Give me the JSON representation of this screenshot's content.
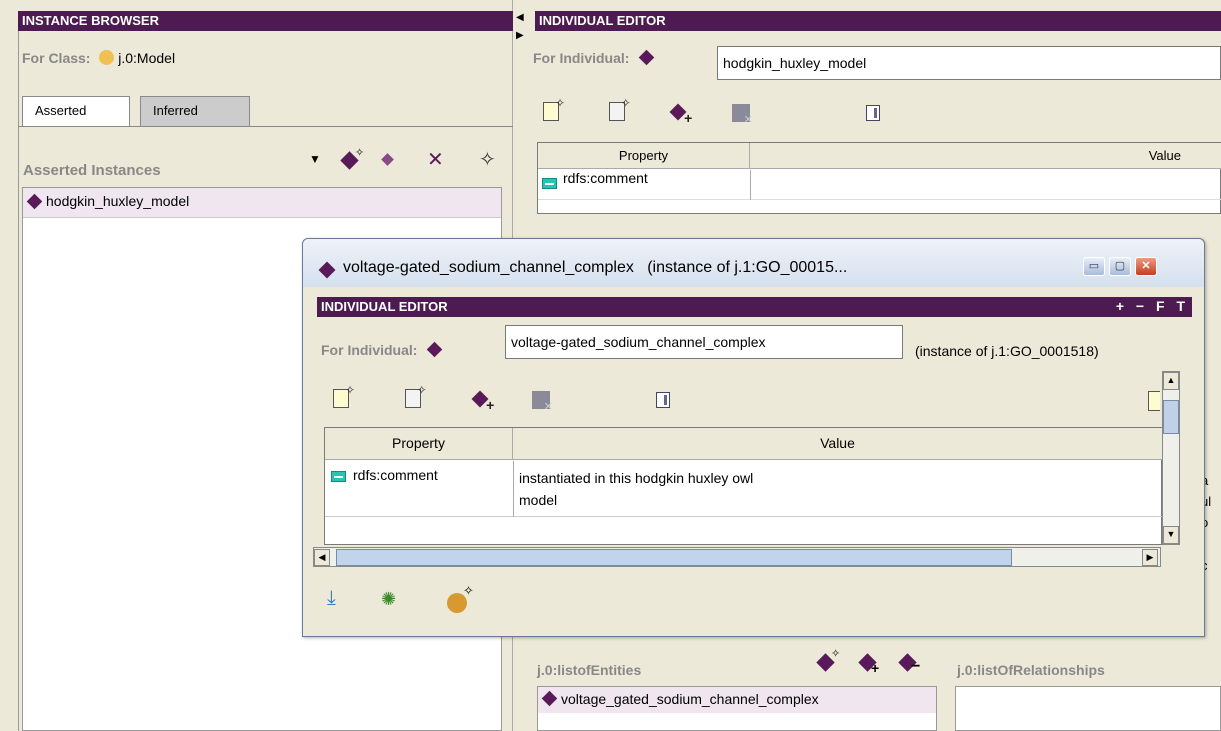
{
  "left": {
    "header": "INSTANCE BROWSER",
    "for_class_label": "For Class:",
    "class_name": "j.0:Model",
    "tabs": [
      {
        "label": "Asserted"
      },
      {
        "label": "Inferred"
      }
    ],
    "section_title": "Asserted Instances",
    "instances": [
      {
        "label": "hodgkin_huxley_model"
      }
    ]
  },
  "right": {
    "header": "INDIVIDUAL EDITOR",
    "for_individual_label": "For Individual:",
    "individual_name": "hodgkin_huxley_model",
    "table": {
      "columns": [
        "Property",
        "Value"
      ],
      "rows": [
        {
          "property": "rdfs:comment",
          "value": ""
        }
      ]
    },
    "list_entities_label": "j.0:listofEntities",
    "list_relationships_label": "j.0:listOfRelationships",
    "entities": [
      {
        "label": "voltage_gated_sodium_channel_complex"
      }
    ],
    "peek_text": [
      "a",
      "ul",
      "o",
      "c"
    ]
  },
  "dialog": {
    "title": "voltage-gated_sodium_channel_complex   (instance of j.1:GO_00015...",
    "header": "INDIVIDUAL EDITOR",
    "header_buttons": [
      "+",
      "−",
      "F",
      "T"
    ],
    "for_individual_label": "For Individual:",
    "individual_name": "voltage-gated_sodium_channel_complex",
    "instance_of": "(instance of j.1:GO_0001518)",
    "table": {
      "columns": [
        "Property",
        "Value"
      ],
      "rows": [
        {
          "property": "rdfs:comment",
          "value": "instantiated in this hodgkin huxley owl\nmodel"
        }
      ]
    }
  }
}
